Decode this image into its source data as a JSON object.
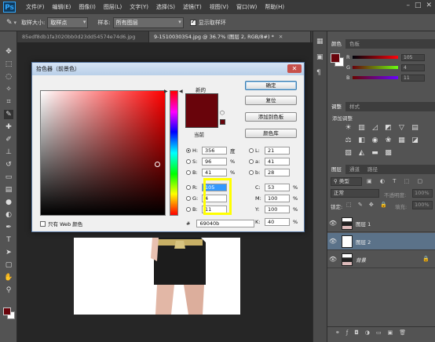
{
  "app": {
    "logo": "Ps",
    "menu": [
      "文件(F)",
      "编辑(E)",
      "图像(I)",
      "图层(L)",
      "文字(Y)",
      "选择(S)",
      "滤镜(T)",
      "视图(V)",
      "窗口(W)",
      "帮助(H)"
    ]
  },
  "options": {
    "sample_size_label": "取样大小:",
    "sample_size_value": "取样点",
    "sample_label": "样本:",
    "sample_value": "所有图层",
    "show_ring_label": "显示取样环"
  },
  "tabs": [
    {
      "label": "85edf8db1fa3020bb0d23dd54574e74d6.jpg",
      "active": false
    },
    {
      "label": "9-1510030354.jpg @ 36.7% (图层 2, RGB/8#) *",
      "active": true
    }
  ],
  "colors": {
    "foreground": "#69040b",
    "current": "#69040b",
    "new": "#69040b",
    "highlight": "#ffff00",
    "selected_layer": "#5b7289"
  },
  "dialog": {
    "title": "拾色器（前景色）",
    "close_glyph": "✕",
    "new_label": "新的",
    "current_label": "当前",
    "buttons": {
      "ok": "确定",
      "reset": "复位",
      "add_swatch": "添加到色板",
      "libraries": "颜色库"
    },
    "hsb": {
      "h": {
        "label": "H:",
        "value": "356",
        "unit": "度"
      },
      "s": {
        "label": "S:",
        "value": "96",
        "unit": "%"
      },
      "b": {
        "label": "B:",
        "value": "41",
        "unit": "%"
      }
    },
    "lab": {
      "l": {
        "label": "L:",
        "value": "21"
      },
      "a": {
        "label": "a:",
        "value": "41"
      },
      "b": {
        "label": "b:",
        "value": "28"
      }
    },
    "rgb": {
      "r": {
        "label": "R:",
        "value": "105"
      },
      "g": {
        "label": "G:",
        "value": "4"
      },
      "b": {
        "label": "B:",
        "value": "11"
      }
    },
    "cmyk": {
      "c": {
        "label": "C:",
        "value": "53",
        "unit": "%"
      },
      "m": {
        "label": "M:",
        "value": "100",
        "unit": "%"
      },
      "y": {
        "label": "Y:",
        "value": "100",
        "unit": "%"
      },
      "k": {
        "label": "K:",
        "value": "40",
        "unit": "%"
      }
    },
    "hex_label": "#",
    "hex_value": "69040b",
    "web_only_label": "只有 Web 颜色"
  },
  "panels": {
    "color_tabs": [
      "颜色",
      "色板"
    ],
    "sliders": [
      {
        "label": "R",
        "value": "105"
      },
      {
        "label": "G",
        "value": "4"
      },
      {
        "label": "B",
        "value": "11"
      }
    ],
    "adjust_tabs": [
      "调整",
      "样式"
    ],
    "adjust_title": "添加调整",
    "layer_tabs": [
      "图层",
      "通道",
      "路径"
    ],
    "filter_value": "类型",
    "blend_mode": "正常",
    "opacity_label": "不透明度:",
    "opacity_value": "100%",
    "lock_label": "锁定:",
    "fill_label": "填充:",
    "fill_value": "100%",
    "layers": [
      {
        "name": "图层 1",
        "selected": false
      },
      {
        "name": "图层 2",
        "selected": true
      },
      {
        "name": "背景",
        "selected": false
      }
    ]
  }
}
